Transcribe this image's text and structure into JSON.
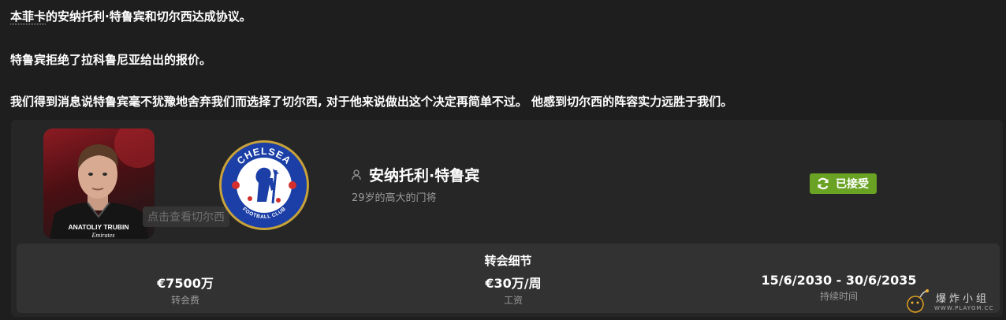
{
  "news": {
    "line1_prefix": "本菲卡",
    "line1_rest": "的安纳托利·特鲁宾和切尔西达成协议。",
    "line2": "特鲁宾拒绝了拉科鲁尼亚给出的报价。",
    "line3": "我们得到消息说特鲁宾毫不犹豫地舍弃我们而选择了切尔西, 对于他来说做出这个决定再简单不过。 他感到切尔西的阵容实力远胜于我们。"
  },
  "player": {
    "shirt_name": "ANATOLIY TRUBIN",
    "sponsor": "Emirates",
    "name": "安纳托利·特鲁宾",
    "description": "29岁的高大的门将",
    "club_hint": "点击查看切尔西"
  },
  "club": {
    "crest_top": "CHELSEA",
    "crest_bottom": "FOOTBALL CLUB"
  },
  "status": {
    "label": "已接受",
    "color": "#6aa324"
  },
  "transfer": {
    "title": "转会细节",
    "fee_value": "€7500万",
    "fee_label": "转会费",
    "wage_value": "€30万/周",
    "wage_label": "工资",
    "duration_value": "15/6/2030 - 30/6/2035",
    "duration_label": "持续时间"
  },
  "watermark": {
    "title": "爆炸小组",
    "subtitle": "WWW.PLAYGM.CC"
  }
}
